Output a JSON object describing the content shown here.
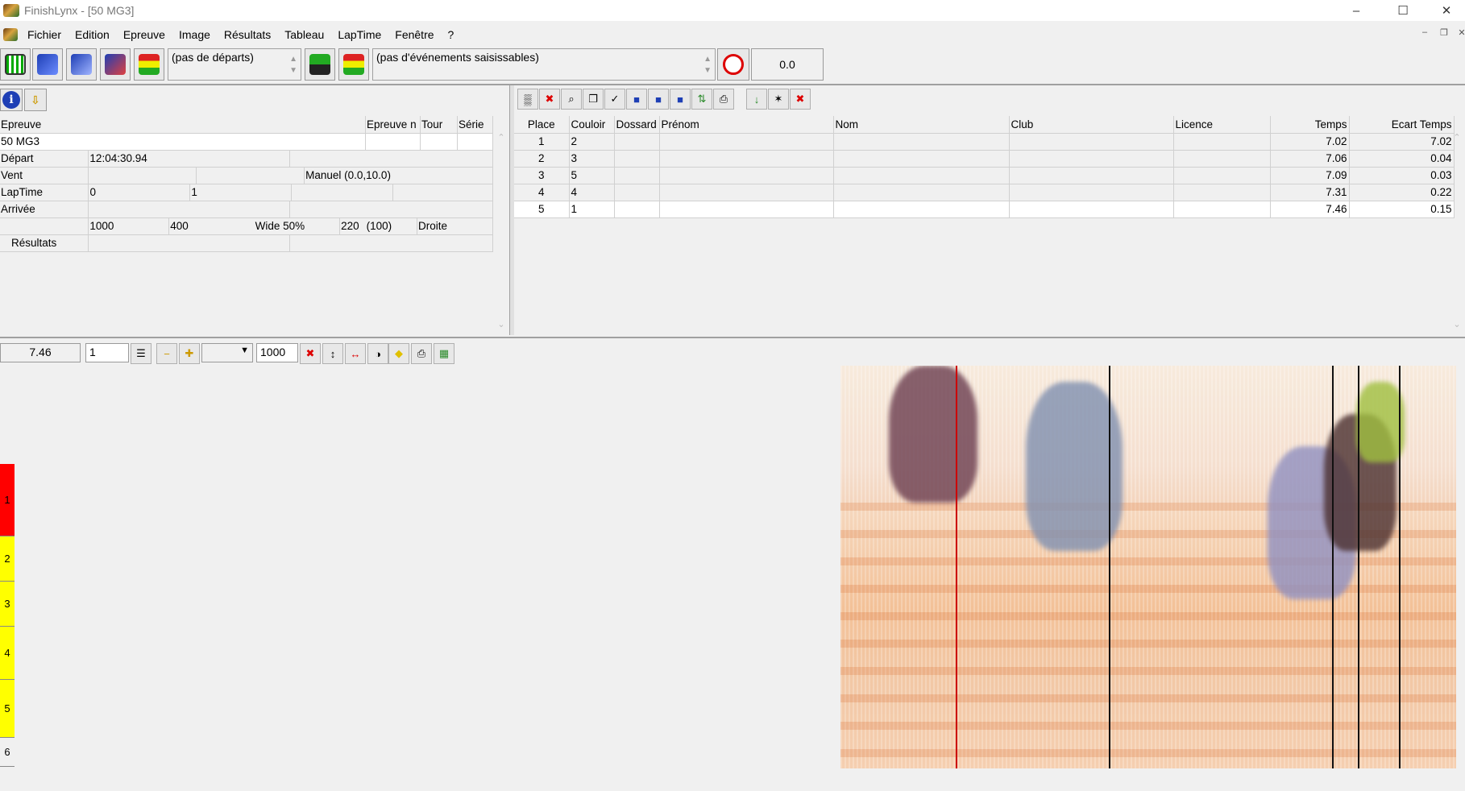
{
  "window": {
    "title": "FinishLynx - [50 MG3]"
  },
  "menu": [
    "Fichier",
    "Edition",
    "Epreuve",
    "Image",
    "Résultats",
    "Tableau",
    "LapTime",
    "Fenêtre",
    "?"
  ],
  "toolbar": {
    "starts_combo": "(pas de départs)",
    "events_combo": "(pas d'événements saisissables)",
    "time_display": "0.0"
  },
  "event_info": {
    "headers": {
      "epreuve": "Epreuve",
      "epreuve_n": "Epreuve n",
      "tour": "Tour",
      "serie": "Série"
    },
    "name": "50 MG3",
    "depart_label": "Départ",
    "depart_value": "12:04:30.94",
    "vent_label": "Vent",
    "vent_value": "Manuel (0.0,10.0)",
    "laptime_label": "LapTime",
    "laptime_a": "0",
    "laptime_b": "1",
    "arrivee_label": "Arrivée",
    "dist_a": "1000",
    "dist_b": "400",
    "wide": "Wide 50%",
    "dist_c": "220",
    "dist_d": "(100)",
    "side": "Droite",
    "resultats_label": "Résultats"
  },
  "results": {
    "headers": [
      "Place",
      "Couloir",
      "Dossard",
      "Prénom",
      "Nom",
      "Club",
      "Licence",
      "Temps",
      "Ecart Temps"
    ],
    "rows": [
      {
        "place": "1",
        "couloir": "2",
        "temps": "7.02",
        "ecart": "7.02"
      },
      {
        "place": "2",
        "couloir": "3",
        "temps": "7.06",
        "ecart": "0.04"
      },
      {
        "place": "3",
        "couloir": "5",
        "temps": "7.09",
        "ecart": "0.03"
      },
      {
        "place": "4",
        "couloir": "4",
        "temps": "7.31",
        "ecart": "0.22"
      },
      {
        "place": "5",
        "couloir": "1",
        "temps": "7.46",
        "ecart": "0.15"
      }
    ]
  },
  "image_bar": {
    "time": "7.46",
    "zoom": "1",
    "density": "1000"
  },
  "lanes": [
    "1",
    "2",
    "3",
    "4",
    "5",
    "6"
  ],
  "colors": {
    "lane_first": "#ff0000",
    "lane_other": "#ffff00",
    "cursor_line": "#cc0000"
  }
}
